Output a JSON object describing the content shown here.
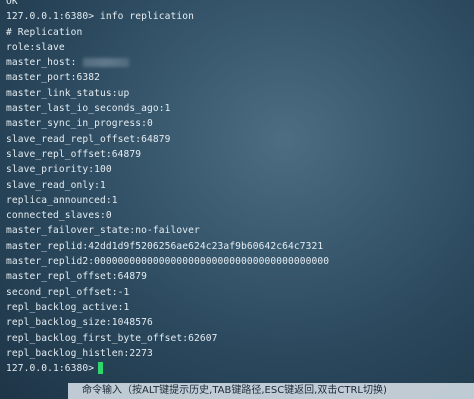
{
  "terminal": {
    "prompt": "127.0.0.1:6380>",
    "command": "info replication",
    "top_partial": "OK",
    "lines": [
      "# Replication",
      "role:slave",
      "master_host:",
      "master_port:6382",
      "master_link_status:up",
      "master_last_io_seconds_ago:1",
      "master_sync_in_progress:0",
      "slave_read_repl_offset:64879",
      "slave_repl_offset:64879",
      "slave_priority:100",
      "slave_read_only:1",
      "replica_announced:1",
      "connected_slaves:0",
      "master_failover_state:no-failover",
      "master_replid:42dd1d9f5206256ae624c23af9b60642c64c7321",
      "master_replid2:0000000000000000000000000000000000000000",
      "master_repl_offset:64879",
      "second_repl_offset:-1",
      "repl_backlog_active:1",
      "repl_backlog_size:1048576",
      "repl_backlog_first_byte_offset:62607",
      "repl_backlog_histlen:2273"
    ],
    "cursor_color": "#2fd66b"
  },
  "statusbar": {
    "hint": "命令输入（按ALT键提示历史,TAB键路径,ESC键返回,双击CTRL切换)"
  }
}
